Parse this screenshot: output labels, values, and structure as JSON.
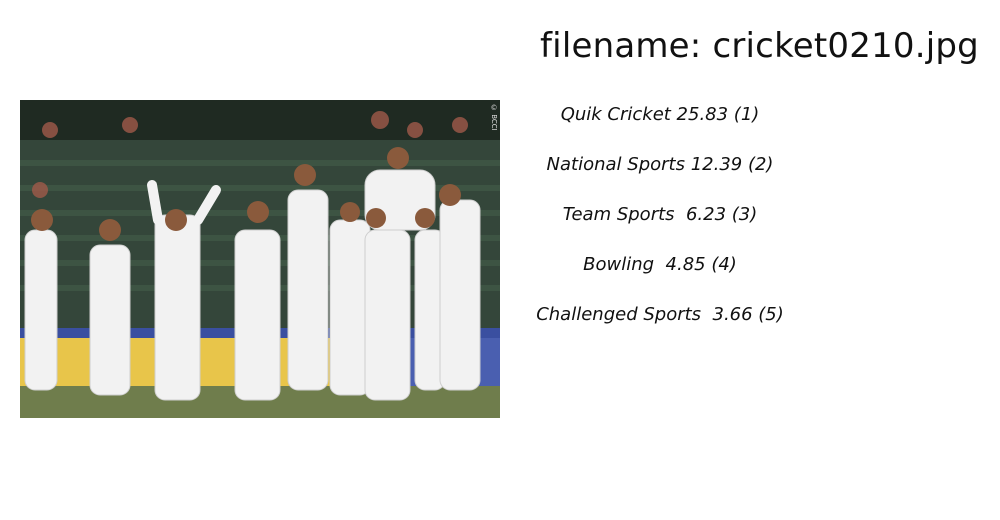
{
  "title": "filename: cricket0210.jpg",
  "image": {
    "alt": "cricket team celebrating on field",
    "credit": "© BCCI"
  },
  "predictions": [
    {
      "text": "Quik Cricket 25.83 (1)"
    },
    {
      "text": "National Sports 12.39 (2)"
    },
    {
      "text": "Team Sports  6.23 (3)"
    },
    {
      "text": "Bowling  4.85 (4)"
    },
    {
      "text": "Challenged Sports  3.66 (5)"
    }
  ]
}
